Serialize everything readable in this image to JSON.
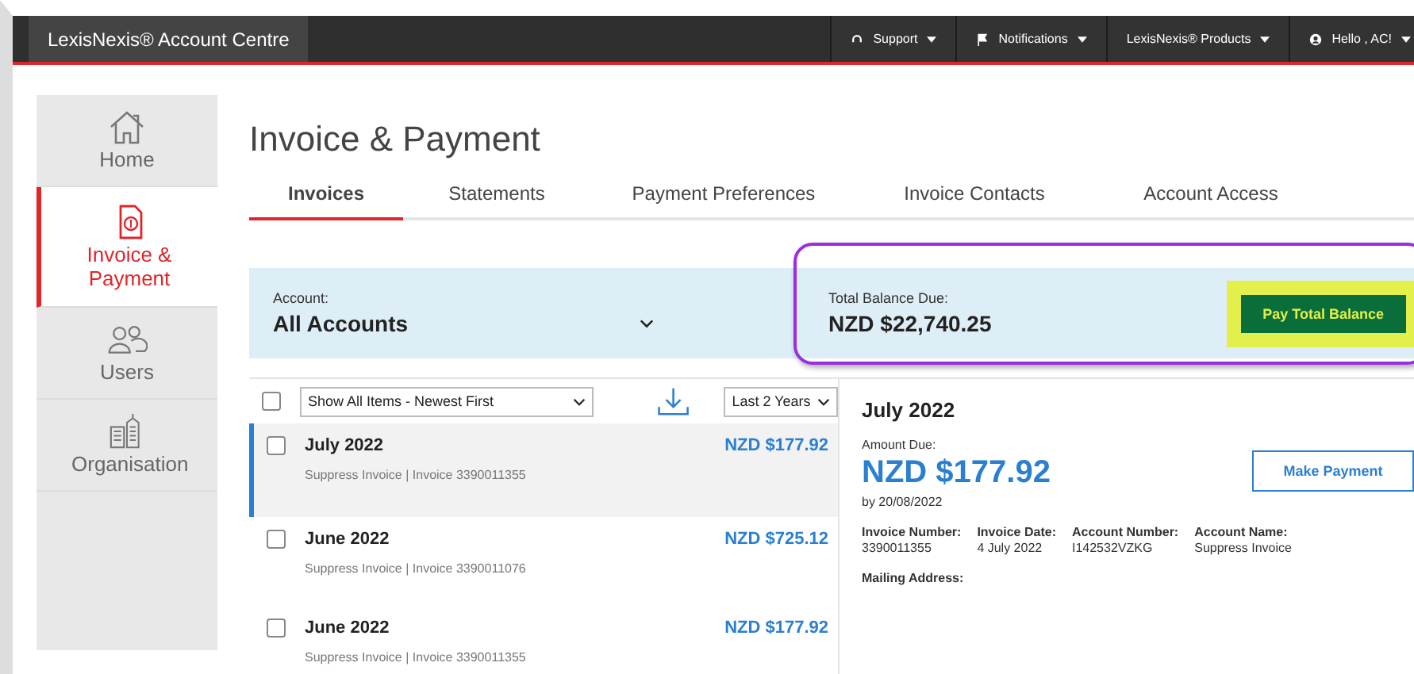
{
  "topbar": {
    "title": "LexisNexis® Account Centre",
    "menus": [
      {
        "label": "Support"
      },
      {
        "label": "Notifications"
      },
      {
        "label": "LexisNexis® Products"
      },
      {
        "label": "Hello , AC!"
      }
    ]
  },
  "sidebar": {
    "items": [
      {
        "label": "Home",
        "selected": false
      },
      {
        "label": "Invoice & Payment",
        "selected": true
      },
      {
        "label": "Users",
        "selected": false
      },
      {
        "label": "Organisation",
        "selected": false
      }
    ]
  },
  "page_title": "Invoice & Payment",
  "tabs": [
    {
      "label": "Invoices",
      "selected": true
    },
    {
      "label": "Statements",
      "selected": false
    },
    {
      "label": "Payment Preferences",
      "selected": false
    },
    {
      "label": "Invoice Contacts",
      "selected": false
    },
    {
      "label": "Account Access",
      "selected": false
    }
  ],
  "account": {
    "label": "Account:",
    "value": "All Accounts"
  },
  "balance": {
    "label": "Total Balance Due:",
    "value": "NZD $22,740.25",
    "button": "Pay Total Balance"
  },
  "filters": {
    "select_all_checked": false,
    "sort": "Show All Items - Newest First",
    "period": "Last 2 Years"
  },
  "invoices": [
    {
      "title": "July 2022",
      "subtitle": "Suppress Invoice | Invoice 3390011355",
      "amount": "NZD $177.92",
      "selected": true,
      "checked": false
    },
    {
      "title": "June 2022",
      "subtitle": "Suppress Invoice | Invoice 3390011076",
      "amount": "NZD $725.12",
      "selected": false,
      "checked": false
    },
    {
      "title": "June 2022",
      "subtitle": "Suppress Invoice | Invoice 3390011355",
      "amount": "NZD $177.92",
      "selected": false,
      "checked": false
    }
  ],
  "detail": {
    "title": "July 2022",
    "amount_label": "Amount Due:",
    "amount": "NZD $177.92",
    "due": "by 20/08/2022",
    "button": "Make Payment",
    "fields": [
      {
        "label": "Invoice Number:",
        "value": "3390011355"
      },
      {
        "label": "Invoice Date:",
        "value": "4 July 2022"
      },
      {
        "label": "Account Number:",
        "value": "I142532VZKG"
      },
      {
        "label": "Account Name:",
        "value": "Suppress Invoice"
      }
    ],
    "mailing_label": "Mailing Address:"
  }
}
